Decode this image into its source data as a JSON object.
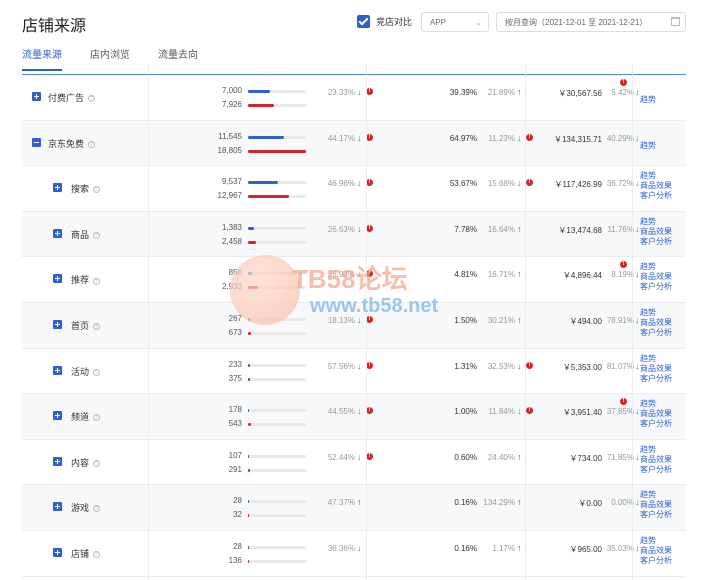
{
  "header": {
    "title": "店铺来源",
    "compare_label": "竞店对比",
    "platform": "APP",
    "date_range": "按月查询（2021-12-01 至 2021-12-21）"
  },
  "tabs": [
    {
      "label": "流量来源",
      "active": true
    },
    {
      "label": "店内浏览",
      "active": false
    },
    {
      "label": "流量去向",
      "active": false
    }
  ],
  "colors": {
    "accent": "#2f5fd0",
    "compare": "#d3222a",
    "up": "#d3222a",
    "down": "#2aa84a"
  },
  "rows": [
    {
      "name": "付费广告",
      "level": 0,
      "open": false,
      "v1": "7,000",
      "v2": "7,926",
      "f1": 0.38,
      "f2": 0.45,
      "c1": "23.33%",
      "a1": "down",
      "w1": true,
      "c2": "39.39%",
      "c3": "21.89%",
      "a3": "up",
      "w3": false,
      "m": "￥30,567.56",
      "c4": "5.42%",
      "a4": "down",
      "w4": true,
      "links": [
        "趋势"
      ]
    },
    {
      "name": "京东免费",
      "level": 0,
      "open": true,
      "v1": "11,545",
      "v2": "18,805",
      "f1": 0.62,
      "f2": 1.0,
      "c1": "44.17%",
      "a1": "down",
      "w1": true,
      "c2": "64.97%",
      "c3": "11.23%",
      "a3": "down",
      "w3": true,
      "m": "￥134,315.71",
      "c4": "40.29%",
      "a4": "down",
      "w4": false,
      "links": [
        "趋势"
      ]
    },
    {
      "name": "搜索",
      "level": 1,
      "open": false,
      "v1": "9,537",
      "v2": "12,967",
      "f1": 0.52,
      "f2": 0.7,
      "c1": "46.96%",
      "a1": "down",
      "w1": true,
      "c2": "53.67%",
      "c3": "15.68%",
      "a3": "down",
      "w3": true,
      "m": "￥117,426.99",
      "c4": "36.72%",
      "a4": "down",
      "w4": false,
      "links": [
        "趋势",
        "商品效果",
        "客户分析"
      ]
    },
    {
      "name": "商品",
      "level": 1,
      "open": false,
      "v1": "1,383",
      "v2": "2,458",
      "f1": 0.1,
      "f2": 0.14,
      "c1": "26.63%",
      "a1": "down",
      "w1": true,
      "c2": "7.78%",
      "c3": "16.64%",
      "a3": "up",
      "w3": false,
      "m": "￥13,474.68",
      "c4": "11.76%",
      "a4": "down",
      "w4": false,
      "links": [
        "趋势",
        "商品效果",
        "客户分析"
      ]
    },
    {
      "name": "推荐",
      "level": 1,
      "open": false,
      "v1": "856",
      "v2": "2,933",
      "f1": 0.07,
      "f2": 0.18,
      "c1": "26.93%",
      "a1": "down",
      "w1": true,
      "c2": "4.81%",
      "c3": "16.71%",
      "a3": "up",
      "w3": false,
      "m": "￥4,896.44",
      "c4": "8.19%",
      "a4": "down",
      "w4": true,
      "links": [
        "趋势",
        "商品效果",
        "客户分析"
      ]
    },
    {
      "name": "首页",
      "level": 1,
      "open": false,
      "v1": "267",
      "v2": "673",
      "f1": 0.03,
      "f2": 0.06,
      "c1": "18.13%",
      "a1": "down",
      "w1": true,
      "c2": "1.50%",
      "c3": "30.21%",
      "a3": "up",
      "w3": false,
      "m": "￥494.00",
      "c4": "78.91%",
      "a4": "down",
      "w4": false,
      "links": [
        "趋势",
        "商品效果",
        "客户分析"
      ]
    },
    {
      "name": "活动",
      "level": 1,
      "open": false,
      "v1": "233",
      "v2": "375",
      "f1": 0.03,
      "f2": 0.04,
      "c1": "57.56%",
      "a1": "down",
      "w1": true,
      "c2": "1.31%",
      "c3": "32.53%",
      "a3": "down",
      "w3": true,
      "m": "￥5,353.00",
      "c4": "81.07%",
      "a4": "down",
      "w4": false,
      "links": [
        "趋势",
        "商品效果",
        "客户分析"
      ]
    },
    {
      "name": "频道",
      "level": 1,
      "open": false,
      "v1": "178",
      "v2": "543",
      "f1": 0.02,
      "f2": 0.05,
      "c1": "44.55%",
      "a1": "down",
      "w1": true,
      "c2": "1.00%",
      "c3": "11.84%",
      "a3": "down",
      "w3": true,
      "m": "￥3,951.40",
      "c4": "37.85%",
      "a4": "down",
      "w4": true,
      "links": [
        "趋势",
        "商品效果",
        "客户分析"
      ]
    },
    {
      "name": "内容",
      "level": 1,
      "open": false,
      "v1": "107",
      "v2": "291",
      "f1": 0.02,
      "f2": 0.03,
      "c1": "52.44%",
      "a1": "down",
      "w1": true,
      "c2": "0.60%",
      "c3": "24.40%",
      "a3": "up",
      "w3": false,
      "m": "￥734.00",
      "c4": "71.85%",
      "a4": "down",
      "w4": false,
      "links": [
        "趋势",
        "商品效果",
        "客户分析"
      ]
    },
    {
      "name": "游戏",
      "level": 1,
      "open": false,
      "v1": "28",
      "v2": "32",
      "f1": 0.01,
      "f2": 0.01,
      "c1": "47.37%",
      "a1": "up",
      "w1": false,
      "c2": "0.16%",
      "c3": "134.29%",
      "a3": "up",
      "w3": false,
      "m": "￥0.00",
      "c4": "0.00%",
      "a4": "down",
      "w4": false,
      "links": [
        "趋势",
        "商品效果",
        "客户分析"
      ]
    },
    {
      "name": "店铺",
      "level": 1,
      "open": false,
      "v1": "28",
      "v2": "136",
      "f1": 0.01,
      "f2": 0.02,
      "c1": "36.36%",
      "a1": "down",
      "w1": false,
      "c2": "0.16%",
      "c3": "1.17%",
      "a3": "up",
      "w3": false,
      "m": "￥965.00",
      "c4": "35.03%",
      "a4": "down",
      "w4": false,
      "links": [
        "趋势",
        "商品效果",
        "客户分析"
      ]
    }
  ],
  "watermark": {
    "line1": "TB58论坛",
    "line2": "www.tb58.net"
  }
}
